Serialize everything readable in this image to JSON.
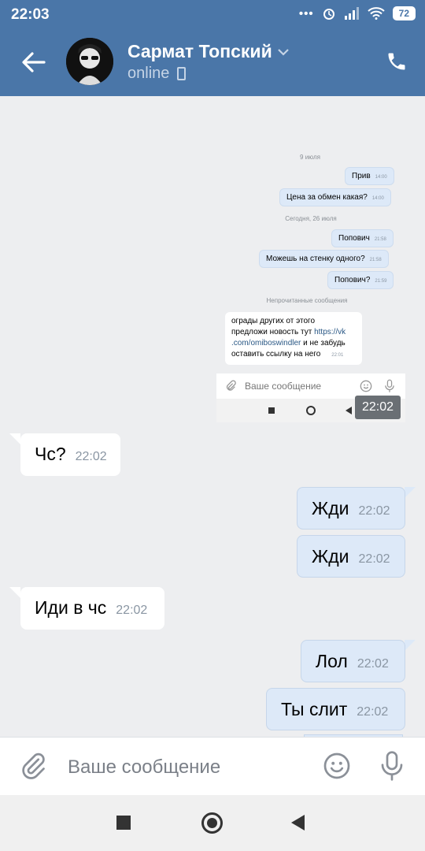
{
  "status_bar": {
    "time": "22:03",
    "dots": "•••",
    "battery": "72"
  },
  "header": {
    "contact_name": "Сармат Топский",
    "status": "online"
  },
  "embedded_screenshot": {
    "date_1": "9 июля",
    "msg_1": "Прив",
    "msg_1_time": "14:00",
    "msg_2": "Цена за обмен какая?",
    "msg_2_time": "14:00",
    "date_2": "Сегодня, 26 июля",
    "msg_3": "Попович",
    "msg_3_time": "21:58",
    "msg_4": "Можешь на стенку одного?",
    "msg_4_time": "21:58",
    "msg_5": "Попович?",
    "msg_5_time": "21:59",
    "unread_label": "Непрочитанные сообщения",
    "incoming_line_1": "ограды других от этого",
    "incoming_line_2_pre": "предложи новость тут ",
    "incoming_link_1": "https://vk",
    "incoming_link_2": ".com/omiboswindler",
    "incoming_line_3_post": " и не забудь",
    "incoming_line_4": "оставить ссылку на него",
    "incoming_time": "22:01",
    "input_placeholder": "Ваше сообщение",
    "tooltip_time": "22:02"
  },
  "messages": [
    {
      "direction": "in",
      "text": "Чс?",
      "time": "22:02"
    },
    {
      "direction": "out",
      "text": "Жди",
      "time": "22:02"
    },
    {
      "direction": "out",
      "text": "Жди",
      "time": "22:02"
    },
    {
      "direction": "in",
      "text": "Иди в чс",
      "time": "22:02"
    },
    {
      "direction": "out",
      "text": "Лол",
      "time": "22:02"
    },
    {
      "direction": "out",
      "text": "Ты слит",
      "time": "22:02"
    }
  ],
  "input": {
    "placeholder": "Ваше сообщение"
  },
  "colors": {
    "header": "#4a76a8",
    "background": "#edeef0",
    "outgoing_bubble": "#dde9f8",
    "incoming_bubble": "#ffffff"
  }
}
